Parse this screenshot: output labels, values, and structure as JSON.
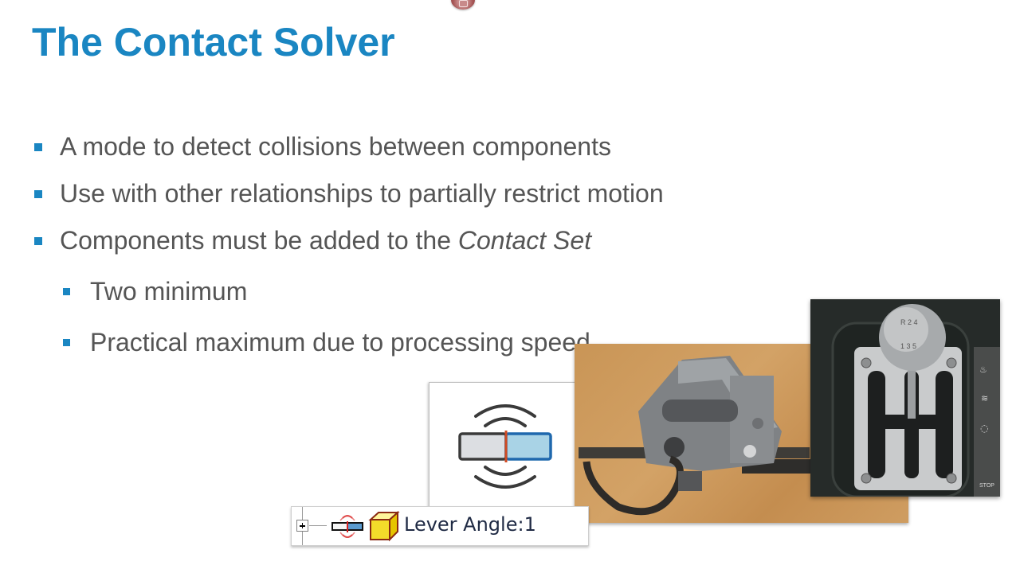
{
  "slide": {
    "title": "The Contact Solver",
    "bullets": [
      {
        "level": 1,
        "text": "A mode to detect collisions between components"
      },
      {
        "level": 1,
        "text": "Use with other relationships to partially restrict motion"
      },
      {
        "level": 1,
        "text_before": "Components must be added to the ",
        "text_italic": "Contact Set"
      },
      {
        "level": 2,
        "text": "Two minimum"
      },
      {
        "level": 2,
        "text": "Practical maximum due to processing speed"
      }
    ],
    "accent_color": "#1a86c2",
    "body_text_color": "#555555"
  },
  "images": {
    "contact_solver_icon": "contact-solver-icon",
    "trigger_photo": "trigger-mechanism-photo",
    "shifter_photo": "gear-shifter-photo",
    "shifter_knob_labels": [
      "R",
      "2",
      "4",
      "1",
      "3",
      "5"
    ],
    "shifter_panel_label": "STOP"
  },
  "browser_tree": {
    "item_label": "Lever Angle:1",
    "expander": "plus-expander-icon",
    "icons": [
      "contact-set-icon",
      "part-cube-icon"
    ]
  },
  "recording_indicator": "record-icon"
}
